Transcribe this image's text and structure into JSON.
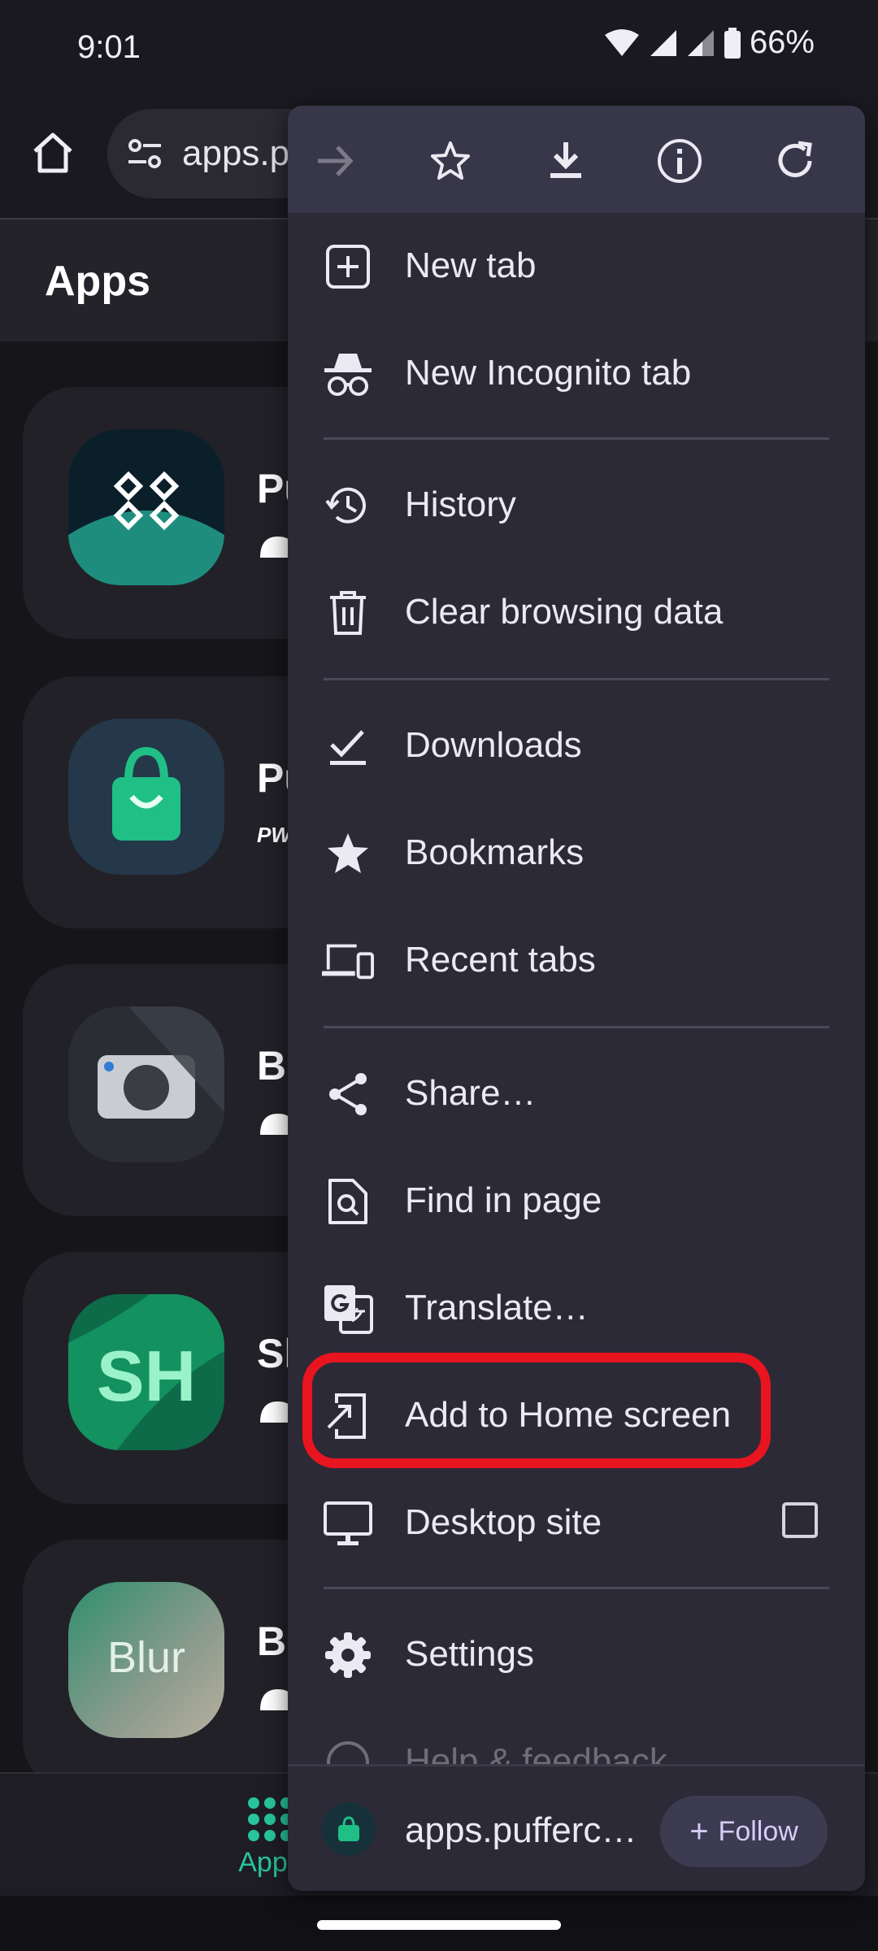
{
  "status_bar": {
    "time": "9:01",
    "battery": "66%"
  },
  "toolbar": {
    "url": "apps.p"
  },
  "page": {
    "title": "Apps"
  },
  "apps": [
    {
      "name": "Pu"
    },
    {
      "name": "Pu",
      "sub": "PW"
    },
    {
      "name": "Bo"
    },
    {
      "name": "Sh",
      "icon_text": "SH"
    },
    {
      "name": "Bl",
      "icon_text": "Blur"
    }
  ],
  "bottom_nav": {
    "apps_label": "Apps"
  },
  "menu": {
    "top_icons": [
      "forward-icon",
      "bookmark-star-icon",
      "download-icon",
      "info-icon",
      "refresh-icon"
    ],
    "items": [
      {
        "label": "New tab",
        "icon": "new-tab-icon"
      },
      {
        "label": "New Incognito tab",
        "icon": "incognito-icon"
      },
      {
        "label": "History",
        "icon": "history-icon"
      },
      {
        "label": "Clear browsing data",
        "icon": "trash-icon"
      },
      {
        "label": "Downloads",
        "icon": "downloads-icon"
      },
      {
        "label": "Bookmarks",
        "icon": "star-icon"
      },
      {
        "label": "Recent tabs",
        "icon": "devices-icon"
      },
      {
        "label": "Share…",
        "icon": "share-icon"
      },
      {
        "label": "Find in page",
        "icon": "find-in-page-icon"
      },
      {
        "label": "Translate…",
        "icon": "translate-icon"
      },
      {
        "label": "Add to Home screen",
        "icon": "add-to-home-icon"
      },
      {
        "label": "Desktop site",
        "icon": "desktop-icon",
        "checked": false
      },
      {
        "label": "Settings",
        "icon": "settings-icon"
      },
      {
        "label": "Help & feedback",
        "icon": "help-icon"
      }
    ],
    "footer": {
      "site": "apps.pufferc…",
      "follow_label": "Follow"
    }
  },
  "highlight_color": "#e8141f",
  "accent_color": "#27c49d"
}
